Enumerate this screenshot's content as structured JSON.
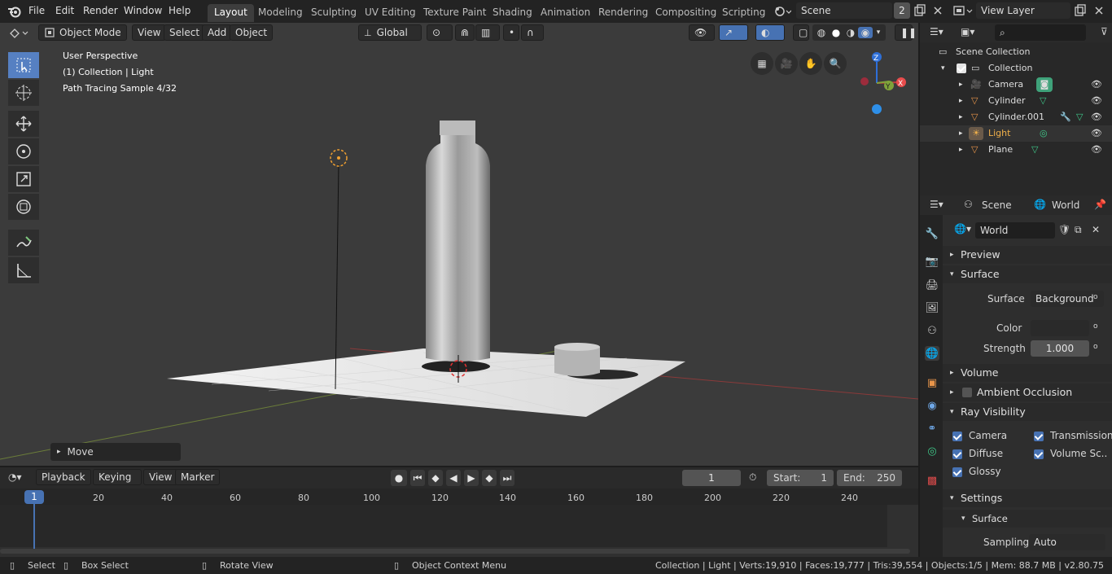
{
  "app": {
    "menus": [
      "File",
      "Edit",
      "Render",
      "Window",
      "Help"
    ],
    "workspaces": [
      "Layout",
      "Modeling",
      "Sculpting",
      "UV Editing",
      "Texture Paint",
      "Shading",
      "Animation",
      "Rendering",
      "Compositing",
      "Scripting"
    ],
    "active_workspace": "Layout",
    "scene": "Scene",
    "scene_users": "2",
    "view_layer": "View Layer"
  },
  "viewport": {
    "mode": "Object Mode",
    "menus": [
      "View",
      "Select",
      "Add",
      "Object"
    ],
    "orientation": "Global",
    "info_lines": [
      "User Perspective",
      "(1) Collection | Light",
      "Path Tracing Sample 4/32"
    ],
    "axes": {
      "x": "X",
      "y": "Y",
      "z": "Z"
    },
    "operator_panel": "Move"
  },
  "outliner": {
    "root": "Scene Collection",
    "collection": "Collection",
    "items": [
      {
        "name": "Camera",
        "color": "#d6d6d6"
      },
      {
        "name": "Cylinder",
        "color": "#d6d6d6"
      },
      {
        "name": "Cylinder.001",
        "color": "#d6d6d6"
      },
      {
        "name": "Light",
        "color": "#f0b04a"
      },
      {
        "name": "Plane",
        "color": "#d6d6d6"
      }
    ]
  },
  "properties": {
    "tabs": {
      "scene": "Scene",
      "world": "World"
    },
    "world_name": "World",
    "panels": {
      "preview": "Preview",
      "surface": "Surface",
      "volume": "Volume",
      "ao": "Ambient Occlusion",
      "ray_visibility": "Ray Visibility",
      "settings": "Settings",
      "settings_surface": "Surface"
    },
    "surface_label": "Surface",
    "surface_value": "Background",
    "color_label": "Color",
    "strength_label": "Strength",
    "strength_value": "1.000",
    "ray_visibility": {
      "camera": "Camera",
      "transmission": "Transmission",
      "diffuse": "Diffuse",
      "volume_scatter": "Volume Sc..",
      "glossy": "Glossy"
    },
    "sampling_label": "Sampling",
    "sampling_value": "Auto"
  },
  "timeline": {
    "menus": [
      "Playback",
      "Keying",
      "View",
      "Marker"
    ],
    "current_frame": "1",
    "start_label": "Start:",
    "start": "1",
    "end_label": "End:",
    "end": "250",
    "ticks": [
      "20",
      "40",
      "60",
      "80",
      "100",
      "120",
      "140",
      "160",
      "180",
      "200",
      "220",
      "240"
    ],
    "playhead": "1"
  },
  "statusbar": {
    "select": "Select",
    "box_select": "Box Select",
    "rotate_view": "Rotate View",
    "context_menu": "Object Context Menu",
    "stats": "Collection | Light | Verts:19,910 | Faces:19,777 | Tris:39,554 | Objects:1/5 | Mem: 88.7 MB | v2.80.75"
  },
  "colors": {
    "accent": "#4772b3",
    "active_ws": "#3d3d3d",
    "light_highlight": "#f0b04a"
  }
}
